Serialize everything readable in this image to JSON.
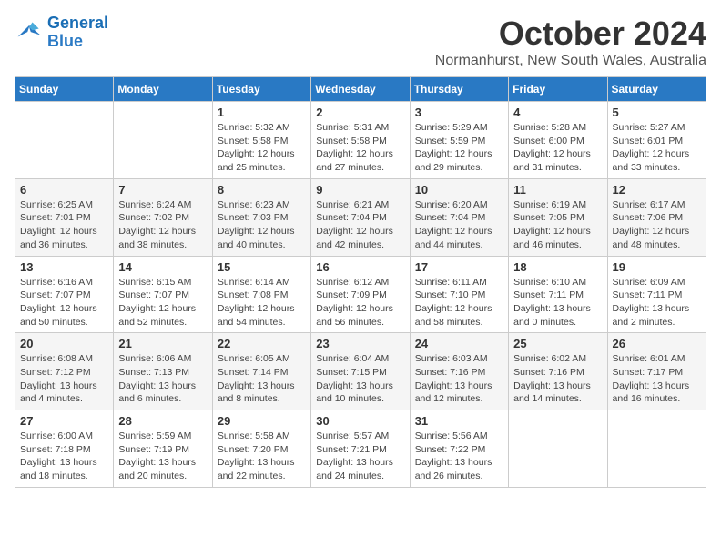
{
  "logo": {
    "line1": "General",
    "line2": "Blue"
  },
  "title": "October 2024",
  "subtitle": "Normanhurst, New South Wales, Australia",
  "weekdays": [
    "Sunday",
    "Monday",
    "Tuesday",
    "Wednesday",
    "Thursday",
    "Friday",
    "Saturday"
  ],
  "weeks": [
    [
      {
        "day": "",
        "info": ""
      },
      {
        "day": "",
        "info": ""
      },
      {
        "day": "1",
        "info": "Sunrise: 5:32 AM\nSunset: 5:58 PM\nDaylight: 12 hours\nand 25 minutes."
      },
      {
        "day": "2",
        "info": "Sunrise: 5:31 AM\nSunset: 5:58 PM\nDaylight: 12 hours\nand 27 minutes."
      },
      {
        "day": "3",
        "info": "Sunrise: 5:29 AM\nSunset: 5:59 PM\nDaylight: 12 hours\nand 29 minutes."
      },
      {
        "day": "4",
        "info": "Sunrise: 5:28 AM\nSunset: 6:00 PM\nDaylight: 12 hours\nand 31 minutes."
      },
      {
        "day": "5",
        "info": "Sunrise: 5:27 AM\nSunset: 6:01 PM\nDaylight: 12 hours\nand 33 minutes."
      }
    ],
    [
      {
        "day": "6",
        "info": "Sunrise: 6:25 AM\nSunset: 7:01 PM\nDaylight: 12 hours\nand 36 minutes."
      },
      {
        "day": "7",
        "info": "Sunrise: 6:24 AM\nSunset: 7:02 PM\nDaylight: 12 hours\nand 38 minutes."
      },
      {
        "day": "8",
        "info": "Sunrise: 6:23 AM\nSunset: 7:03 PM\nDaylight: 12 hours\nand 40 minutes."
      },
      {
        "day": "9",
        "info": "Sunrise: 6:21 AM\nSunset: 7:04 PM\nDaylight: 12 hours\nand 42 minutes."
      },
      {
        "day": "10",
        "info": "Sunrise: 6:20 AM\nSunset: 7:04 PM\nDaylight: 12 hours\nand 44 minutes."
      },
      {
        "day": "11",
        "info": "Sunrise: 6:19 AM\nSunset: 7:05 PM\nDaylight: 12 hours\nand 46 minutes."
      },
      {
        "day": "12",
        "info": "Sunrise: 6:17 AM\nSunset: 7:06 PM\nDaylight: 12 hours\nand 48 minutes."
      }
    ],
    [
      {
        "day": "13",
        "info": "Sunrise: 6:16 AM\nSunset: 7:07 PM\nDaylight: 12 hours\nand 50 minutes."
      },
      {
        "day": "14",
        "info": "Sunrise: 6:15 AM\nSunset: 7:07 PM\nDaylight: 12 hours\nand 52 minutes."
      },
      {
        "day": "15",
        "info": "Sunrise: 6:14 AM\nSunset: 7:08 PM\nDaylight: 12 hours\nand 54 minutes."
      },
      {
        "day": "16",
        "info": "Sunrise: 6:12 AM\nSunset: 7:09 PM\nDaylight: 12 hours\nand 56 minutes."
      },
      {
        "day": "17",
        "info": "Sunrise: 6:11 AM\nSunset: 7:10 PM\nDaylight: 12 hours\nand 58 minutes."
      },
      {
        "day": "18",
        "info": "Sunrise: 6:10 AM\nSunset: 7:11 PM\nDaylight: 13 hours\nand 0 minutes."
      },
      {
        "day": "19",
        "info": "Sunrise: 6:09 AM\nSunset: 7:11 PM\nDaylight: 13 hours\nand 2 minutes."
      }
    ],
    [
      {
        "day": "20",
        "info": "Sunrise: 6:08 AM\nSunset: 7:12 PM\nDaylight: 13 hours\nand 4 minutes."
      },
      {
        "day": "21",
        "info": "Sunrise: 6:06 AM\nSunset: 7:13 PM\nDaylight: 13 hours\nand 6 minutes."
      },
      {
        "day": "22",
        "info": "Sunrise: 6:05 AM\nSunset: 7:14 PM\nDaylight: 13 hours\nand 8 minutes."
      },
      {
        "day": "23",
        "info": "Sunrise: 6:04 AM\nSunset: 7:15 PM\nDaylight: 13 hours\nand 10 minutes."
      },
      {
        "day": "24",
        "info": "Sunrise: 6:03 AM\nSunset: 7:16 PM\nDaylight: 13 hours\nand 12 minutes."
      },
      {
        "day": "25",
        "info": "Sunrise: 6:02 AM\nSunset: 7:16 PM\nDaylight: 13 hours\nand 14 minutes."
      },
      {
        "day": "26",
        "info": "Sunrise: 6:01 AM\nSunset: 7:17 PM\nDaylight: 13 hours\nand 16 minutes."
      }
    ],
    [
      {
        "day": "27",
        "info": "Sunrise: 6:00 AM\nSunset: 7:18 PM\nDaylight: 13 hours\nand 18 minutes."
      },
      {
        "day": "28",
        "info": "Sunrise: 5:59 AM\nSunset: 7:19 PM\nDaylight: 13 hours\nand 20 minutes."
      },
      {
        "day": "29",
        "info": "Sunrise: 5:58 AM\nSunset: 7:20 PM\nDaylight: 13 hours\nand 22 minutes."
      },
      {
        "day": "30",
        "info": "Sunrise: 5:57 AM\nSunset: 7:21 PM\nDaylight: 13 hours\nand 24 minutes."
      },
      {
        "day": "31",
        "info": "Sunrise: 5:56 AM\nSunset: 7:22 PM\nDaylight: 13 hours\nand 26 minutes."
      },
      {
        "day": "",
        "info": ""
      },
      {
        "day": "",
        "info": ""
      }
    ]
  ]
}
